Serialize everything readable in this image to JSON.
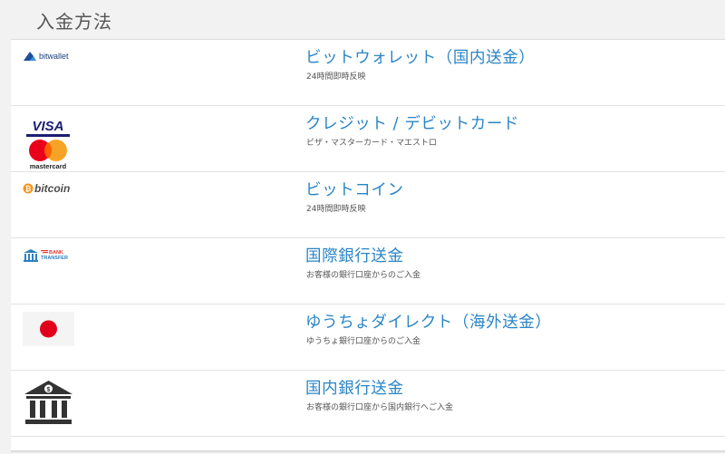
{
  "header": {
    "title": "入金方法"
  },
  "methods": [
    {
      "title": "ビットウォレット（国内送金）",
      "subtitle": "24時間即時反映",
      "logo_text": "bitwallet",
      "logo": "bitwallet-logo"
    },
    {
      "title": "クレジット / デビットカード",
      "subtitle": "ビザ・マスターカード・マエストロ",
      "logo_text_1": "VISA",
      "logo_text_2": "mastercard",
      "logo": "visa-mastercard-logo"
    },
    {
      "title": "ビットコイン",
      "subtitle": "24時間即時反映",
      "logo_text": "bitcoin",
      "logo": "bitcoin-logo"
    },
    {
      "title": "国際銀行送金",
      "subtitle": "お客様の銀行口座からのご入金",
      "logo_text_1": "BANK",
      "logo_text_2": "TRANSFER",
      "logo": "bank-transfer-logo"
    },
    {
      "title": "ゆうちょダイレクト（海外送金）",
      "subtitle": "ゆうちょ銀行口座からのご入金",
      "logo": "japan-flag-logo"
    },
    {
      "title": "国内銀行送金",
      "subtitle": "お客様の銀行口座から国内銀行へご入金",
      "logo_text": "$",
      "logo": "bank-building-logo"
    }
  ],
  "colors": {
    "link_blue": "#2a85c6",
    "visa_blue": "#1a1f71",
    "mastercard_red": "#eb001b",
    "mastercard_orange": "#f79e1b",
    "bitcoin_orange": "#f7931a",
    "flag_red": "#e0001b",
    "bank_blue": "#2b7fc0"
  }
}
